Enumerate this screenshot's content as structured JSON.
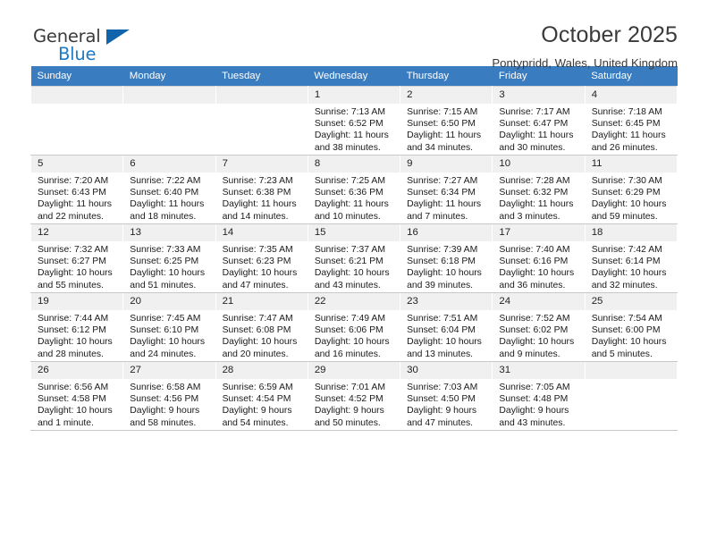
{
  "brand": {
    "name_part1": "General",
    "name_part2": "Blue",
    "accent_color": "#1d7ac4",
    "triangle_color": "#1064ab"
  },
  "header": {
    "month_title": "October 2025",
    "location": "Pontypridd, Wales, United Kingdom",
    "header_bg": "#3a7cc0"
  },
  "weekday_headers": [
    "Sunday",
    "Monday",
    "Tuesday",
    "Wednesday",
    "Thursday",
    "Friday",
    "Saturday"
  ],
  "weeks": [
    [
      {
        "day": "",
        "empty": true
      },
      {
        "day": "",
        "empty": true
      },
      {
        "day": "",
        "empty": true
      },
      {
        "day": "1",
        "sunrise": "Sunrise: 7:13 AM",
        "sunset": "Sunset: 6:52 PM",
        "daylight_1": "Daylight: 11 hours",
        "daylight_2": "and 38 minutes."
      },
      {
        "day": "2",
        "sunrise": "Sunrise: 7:15 AM",
        "sunset": "Sunset: 6:50 PM",
        "daylight_1": "Daylight: 11 hours",
        "daylight_2": "and 34 minutes."
      },
      {
        "day": "3",
        "sunrise": "Sunrise: 7:17 AM",
        "sunset": "Sunset: 6:47 PM",
        "daylight_1": "Daylight: 11 hours",
        "daylight_2": "and 30 minutes."
      },
      {
        "day": "4",
        "sunrise": "Sunrise: 7:18 AM",
        "sunset": "Sunset: 6:45 PM",
        "daylight_1": "Daylight: 11 hours",
        "daylight_2": "and 26 minutes."
      }
    ],
    [
      {
        "day": "5",
        "sunrise": "Sunrise: 7:20 AM",
        "sunset": "Sunset: 6:43 PM",
        "daylight_1": "Daylight: 11 hours",
        "daylight_2": "and 22 minutes."
      },
      {
        "day": "6",
        "sunrise": "Sunrise: 7:22 AM",
        "sunset": "Sunset: 6:40 PM",
        "daylight_1": "Daylight: 11 hours",
        "daylight_2": "and 18 minutes."
      },
      {
        "day": "7",
        "sunrise": "Sunrise: 7:23 AM",
        "sunset": "Sunset: 6:38 PM",
        "daylight_1": "Daylight: 11 hours",
        "daylight_2": "and 14 minutes."
      },
      {
        "day": "8",
        "sunrise": "Sunrise: 7:25 AM",
        "sunset": "Sunset: 6:36 PM",
        "daylight_1": "Daylight: 11 hours",
        "daylight_2": "and 10 minutes."
      },
      {
        "day": "9",
        "sunrise": "Sunrise: 7:27 AM",
        "sunset": "Sunset: 6:34 PM",
        "daylight_1": "Daylight: 11 hours",
        "daylight_2": "and 7 minutes."
      },
      {
        "day": "10",
        "sunrise": "Sunrise: 7:28 AM",
        "sunset": "Sunset: 6:32 PM",
        "daylight_1": "Daylight: 11 hours",
        "daylight_2": "and 3 minutes."
      },
      {
        "day": "11",
        "sunrise": "Sunrise: 7:30 AM",
        "sunset": "Sunset: 6:29 PM",
        "daylight_1": "Daylight: 10 hours",
        "daylight_2": "and 59 minutes."
      }
    ],
    [
      {
        "day": "12",
        "sunrise": "Sunrise: 7:32 AM",
        "sunset": "Sunset: 6:27 PM",
        "daylight_1": "Daylight: 10 hours",
        "daylight_2": "and 55 minutes."
      },
      {
        "day": "13",
        "sunrise": "Sunrise: 7:33 AM",
        "sunset": "Sunset: 6:25 PM",
        "daylight_1": "Daylight: 10 hours",
        "daylight_2": "and 51 minutes."
      },
      {
        "day": "14",
        "sunrise": "Sunrise: 7:35 AM",
        "sunset": "Sunset: 6:23 PM",
        "daylight_1": "Daylight: 10 hours",
        "daylight_2": "and 47 minutes."
      },
      {
        "day": "15",
        "sunrise": "Sunrise: 7:37 AM",
        "sunset": "Sunset: 6:21 PM",
        "daylight_1": "Daylight: 10 hours",
        "daylight_2": "and 43 minutes."
      },
      {
        "day": "16",
        "sunrise": "Sunrise: 7:39 AM",
        "sunset": "Sunset: 6:18 PM",
        "daylight_1": "Daylight: 10 hours",
        "daylight_2": "and 39 minutes."
      },
      {
        "day": "17",
        "sunrise": "Sunrise: 7:40 AM",
        "sunset": "Sunset: 6:16 PM",
        "daylight_1": "Daylight: 10 hours",
        "daylight_2": "and 36 minutes."
      },
      {
        "day": "18",
        "sunrise": "Sunrise: 7:42 AM",
        "sunset": "Sunset: 6:14 PM",
        "daylight_1": "Daylight: 10 hours",
        "daylight_2": "and 32 minutes."
      }
    ],
    [
      {
        "day": "19",
        "sunrise": "Sunrise: 7:44 AM",
        "sunset": "Sunset: 6:12 PM",
        "daylight_1": "Daylight: 10 hours",
        "daylight_2": "and 28 minutes."
      },
      {
        "day": "20",
        "sunrise": "Sunrise: 7:45 AM",
        "sunset": "Sunset: 6:10 PM",
        "daylight_1": "Daylight: 10 hours",
        "daylight_2": "and 24 minutes."
      },
      {
        "day": "21",
        "sunrise": "Sunrise: 7:47 AM",
        "sunset": "Sunset: 6:08 PM",
        "daylight_1": "Daylight: 10 hours",
        "daylight_2": "and 20 minutes."
      },
      {
        "day": "22",
        "sunrise": "Sunrise: 7:49 AM",
        "sunset": "Sunset: 6:06 PM",
        "daylight_1": "Daylight: 10 hours",
        "daylight_2": "and 16 minutes."
      },
      {
        "day": "23",
        "sunrise": "Sunrise: 7:51 AM",
        "sunset": "Sunset: 6:04 PM",
        "daylight_1": "Daylight: 10 hours",
        "daylight_2": "and 13 minutes."
      },
      {
        "day": "24",
        "sunrise": "Sunrise: 7:52 AM",
        "sunset": "Sunset: 6:02 PM",
        "daylight_1": "Daylight: 10 hours",
        "daylight_2": "and 9 minutes."
      },
      {
        "day": "25",
        "sunrise": "Sunrise: 7:54 AM",
        "sunset": "Sunset: 6:00 PM",
        "daylight_1": "Daylight: 10 hours",
        "daylight_2": "and 5 minutes."
      }
    ],
    [
      {
        "day": "26",
        "sunrise": "Sunrise: 6:56 AM",
        "sunset": "Sunset: 4:58 PM",
        "daylight_1": "Daylight: 10 hours",
        "daylight_2": "and 1 minute."
      },
      {
        "day": "27",
        "sunrise": "Sunrise: 6:58 AM",
        "sunset": "Sunset: 4:56 PM",
        "daylight_1": "Daylight: 9 hours",
        "daylight_2": "and 58 minutes."
      },
      {
        "day": "28",
        "sunrise": "Sunrise: 6:59 AM",
        "sunset": "Sunset: 4:54 PM",
        "daylight_1": "Daylight: 9 hours",
        "daylight_2": "and 54 minutes."
      },
      {
        "day": "29",
        "sunrise": "Sunrise: 7:01 AM",
        "sunset": "Sunset: 4:52 PM",
        "daylight_1": "Daylight: 9 hours",
        "daylight_2": "and 50 minutes."
      },
      {
        "day": "30",
        "sunrise": "Sunrise: 7:03 AM",
        "sunset": "Sunset: 4:50 PM",
        "daylight_1": "Daylight: 9 hours",
        "daylight_2": "and 47 minutes."
      },
      {
        "day": "31",
        "sunrise": "Sunrise: 7:05 AM",
        "sunset": "Sunset: 4:48 PM",
        "daylight_1": "Daylight: 9 hours",
        "daylight_2": "and 43 minutes."
      },
      {
        "day": "",
        "empty": true
      }
    ]
  ]
}
